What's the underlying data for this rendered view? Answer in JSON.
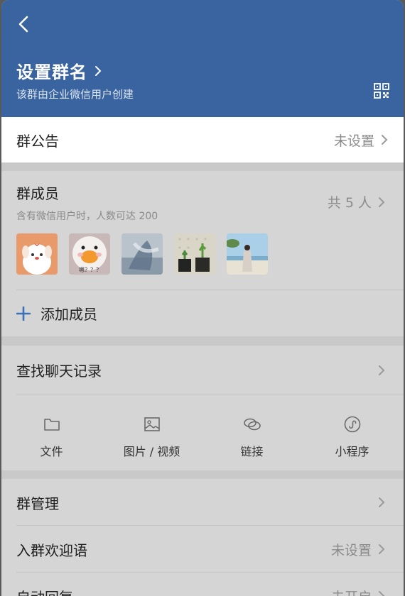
{
  "header": {
    "group_name": "设置群名",
    "subtitle": "该群由企业微信用户创建"
  },
  "notice": {
    "label": "群公告",
    "value": "未设置"
  },
  "members": {
    "title": "群成员",
    "hint": "含有微信用户时，人数可达 200",
    "count": "共 5 人",
    "avatars": [
      {
        "name": "avatar-cartoon-dog"
      },
      {
        "name": "avatar-duck",
        "caption": "嗯？？？"
      },
      {
        "name": "avatar-motion-photo"
      },
      {
        "name": "avatar-plants"
      },
      {
        "name": "avatar-beach-person"
      }
    ],
    "add_label": "添加成员"
  },
  "search": {
    "label": "查找聊天记录",
    "quick": [
      {
        "label": "文件",
        "icon": "folder-icon"
      },
      {
        "label": "图片 / 视频",
        "icon": "image-icon"
      },
      {
        "label": "链接",
        "icon": "link-icon"
      },
      {
        "label": "小程序",
        "icon": "mini-program-icon"
      }
    ]
  },
  "list": [
    {
      "label": "群管理",
      "value": ""
    },
    {
      "label": "入群欢迎语",
      "value": "未设置"
    },
    {
      "label": "自动回复",
      "value": "未开启"
    }
  ],
  "colors": {
    "header": "#3964a0",
    "accent": "#3b6fb6",
    "muted": "#8b8b8b"
  }
}
